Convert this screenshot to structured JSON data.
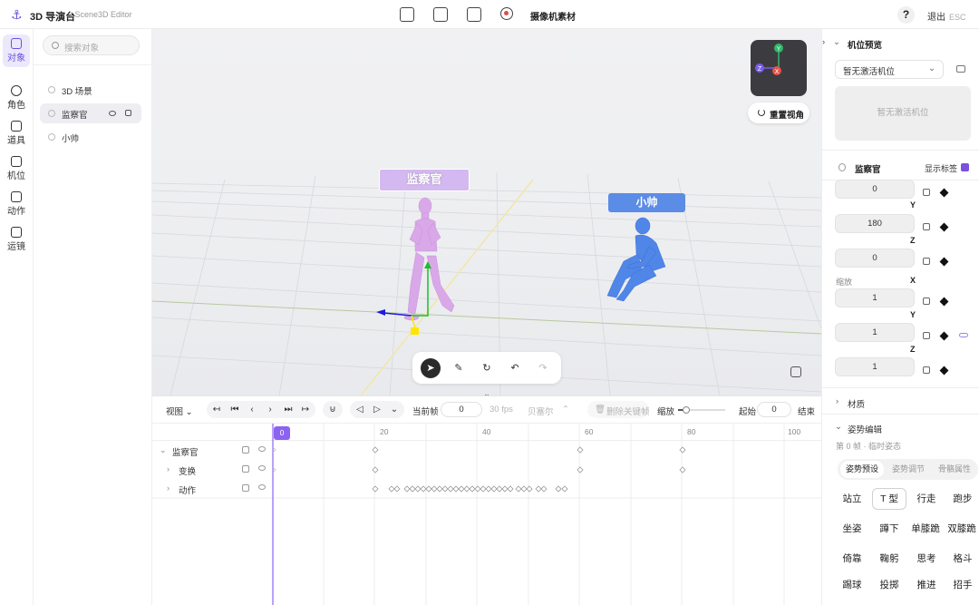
{
  "topbar": {
    "title": "3D 导演台",
    "subtitle": "· Scene3D Editor",
    "camera_asset": "摄像机素材",
    "help": "?",
    "exit": "退出",
    "exit_key": "ESC"
  },
  "leftrail": {
    "items": [
      {
        "label": "对象",
        "icon": "cube-icon",
        "active": true
      },
      {
        "label": "角色",
        "icon": "person-icon"
      },
      {
        "label": "道具",
        "icon": "star-icon"
      },
      {
        "label": "机位",
        "icon": "camera-icon"
      },
      {
        "label": "动作",
        "icon": "running-icon"
      },
      {
        "label": "运镜",
        "icon": "camera-move-icon"
      }
    ]
  },
  "objects": {
    "search_placeholder": "搜索对象",
    "items": [
      {
        "label": "3D 场景"
      },
      {
        "label": "监察官",
        "selected": true
      },
      {
        "label": "小帅"
      }
    ]
  },
  "viewport": {
    "gizmo": {
      "y": "Y",
      "z": "Z",
      "x": "X"
    },
    "reset_view": "重置视角",
    "characters": {
      "a": "监察官",
      "b": "小帅"
    }
  },
  "timeline": {
    "view": "视图",
    "current_frame_label": "当前帧",
    "current_frame": "0",
    "fps": "30 fps",
    "copy_frame": "贝塞尔",
    "delete_keyframe": "删除关键帧",
    "zoom": "缩放",
    "zoom_level": 0.18,
    "start_label": "起始",
    "start": "0",
    "end_label": "结束",
    "ruler": [
      "20",
      "40",
      "60",
      "80",
      "100"
    ],
    "playhead": "0",
    "tracks": [
      {
        "name": "监察官",
        "caret": "⌄"
      },
      {
        "name": "变换",
        "caret": "›"
      },
      {
        "name": "动作",
        "caret": "›"
      }
    ]
  },
  "right": {
    "cam_section": "机位预览",
    "cam_select": "暂无激活机位",
    "cam_preview": "暂无激活机位",
    "object_name": "监察官",
    "show_label": "显示标签",
    "rotation_values": [
      {
        "value": "0",
        "axis": "Y"
      },
      {
        "value": "180",
        "axis": "Z"
      },
      {
        "value": "0",
        "axis": ""
      }
    ],
    "scale_label": "缩放",
    "scale_axis_x": "X",
    "scale_values": [
      {
        "value": "1",
        "axis": "Y"
      },
      {
        "value": "1",
        "axis": "Z"
      },
      {
        "value": "1",
        "axis": ""
      }
    ],
    "material": "材质",
    "pose_edit": "姿势编辑",
    "pose_sub": "第 0 帧 · 临时姿态",
    "tabs": [
      "姿势预设",
      "姿势调节",
      "骨骼属性"
    ],
    "poses": [
      "站立",
      "T 型",
      "行走",
      "跑步",
      "坐姿",
      "蹲下",
      "单膝跪",
      "双膝跪",
      "倚靠",
      "鞠躬",
      "思考",
      "格斗",
      "踢球",
      "投掷",
      "推进",
      "招手"
    ]
  },
  "colors": {
    "accent": "#8b63f0",
    "label_a": "#d4b9f0",
    "label_b": "#5b8ce6",
    "figure_a": "#d9a8e8",
    "figure_b": "#4f86e8"
  }
}
